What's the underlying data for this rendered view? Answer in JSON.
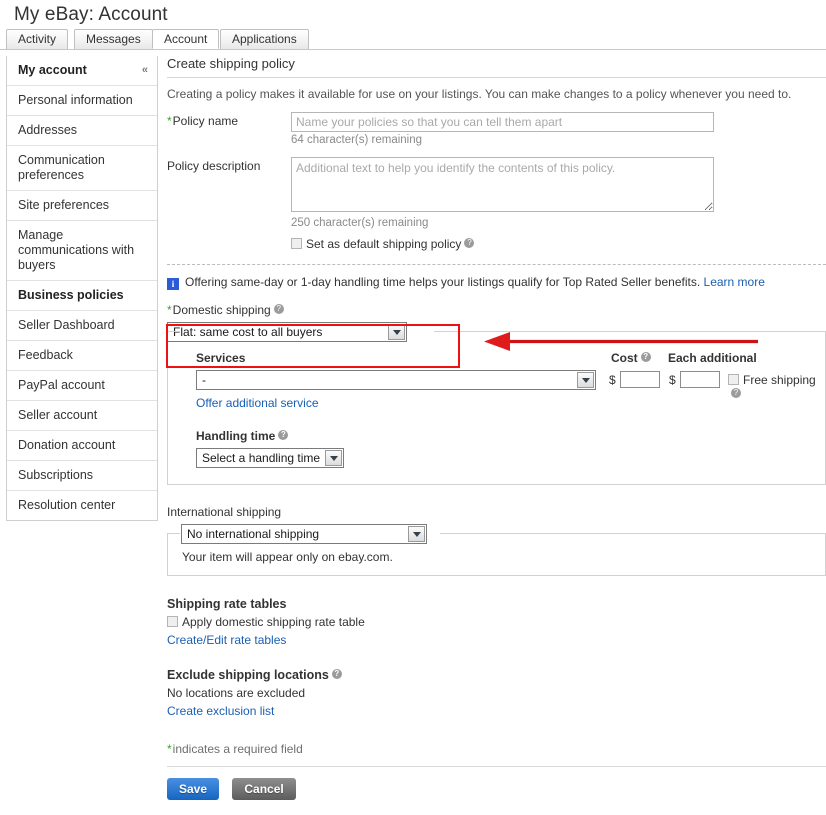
{
  "header": {
    "title": "My eBay: Account",
    "tabs": [
      {
        "label": "Activity",
        "active": false
      },
      {
        "label": "Messages",
        "active": false
      },
      {
        "label": "Account",
        "active": true
      },
      {
        "label": "Applications",
        "active": false
      }
    ]
  },
  "sidebar": {
    "title": "My account",
    "collapse_icon": "«",
    "items": [
      {
        "label": "Personal information"
      },
      {
        "label": "Addresses"
      },
      {
        "label": "Communication preferences"
      },
      {
        "label": "Site preferences"
      },
      {
        "label": "Manage communications with buyers"
      },
      {
        "label": "Business policies"
      },
      {
        "label": "Seller Dashboard"
      },
      {
        "label": "Feedback"
      },
      {
        "label": "PayPal account"
      },
      {
        "label": "Seller account"
      },
      {
        "label": "Donation account"
      },
      {
        "label": "Subscriptions"
      },
      {
        "label": "Resolution center"
      }
    ]
  },
  "main": {
    "section_title": "Create shipping policy",
    "intro": "Creating a policy makes it available for use on your listings. You can make changes to a policy whenever you need to.",
    "policy_name": {
      "label": "Policy name",
      "required_mark": "*",
      "value": "",
      "placeholder": "Name your policies so that you can tell them apart",
      "counter": "64 character(s) remaining"
    },
    "policy_description": {
      "label": "Policy description",
      "value": "",
      "placeholder": "Additional text to help you identify the contents of this policy.",
      "counter": "250 character(s) remaining"
    },
    "default_policy": {
      "label": "Set as default shipping policy",
      "checked": false,
      "help_icon": "?"
    },
    "info_banner": {
      "icon": "i",
      "text": "Offering same-day or 1-day handling time helps your listings qualify for Top Rated Seller benefits.",
      "link": "Learn more"
    },
    "domestic": {
      "label": "Domestic shipping",
      "required_mark": "*",
      "help_icon": "?",
      "selected": "Flat: same cost to all buyers",
      "services_header": "Services",
      "cost_header": "Cost",
      "cost_help": "?",
      "each_additional_header": "Each additional",
      "service_selected": "-",
      "cost_symbol": "$",
      "cost_value": "",
      "each_additional_symbol": "$",
      "each_additional_value": "",
      "free_shipping_label": "Free shipping",
      "free_shipping_checked": false,
      "free_shipping_help": "?",
      "offer_additional_link": "Offer additional service",
      "handling_label": "Handling time",
      "handling_help": "?",
      "handling_selected": "Select a handling time"
    },
    "international": {
      "label": "International shipping",
      "selected": "No international shipping",
      "note": "Your item will appear only on ebay.com."
    },
    "rate_tables": {
      "heading": "Shipping rate tables",
      "checkbox_label": "Apply domestic shipping rate table",
      "checked": false,
      "link": "Create/Edit rate tables"
    },
    "exclude": {
      "heading": "Exclude shipping locations",
      "help_icon": "?",
      "status": "No locations are excluded",
      "link": "Create exclusion list"
    },
    "required_note": {
      "mark": "*",
      "text": "indicates a required field"
    },
    "buttons": {
      "save": "Save",
      "cancel": "Cancel"
    }
  },
  "annotations": {
    "highlight_color": "#ee1111",
    "arrow_color": "#cc1414",
    "highlight_target": "domestic-shipping-group",
    "arrow_direction": "left"
  }
}
